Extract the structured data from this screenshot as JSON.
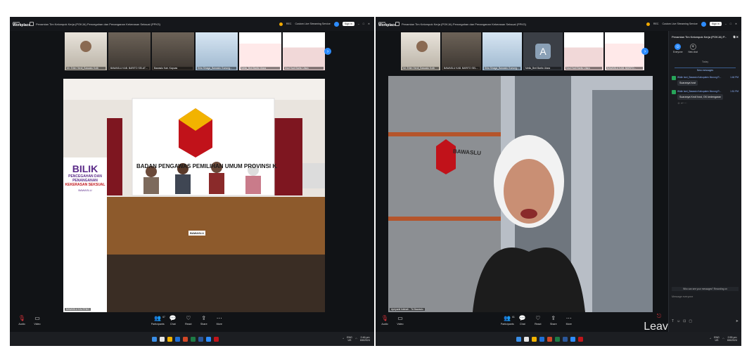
{
  "app": {
    "brand_top": "zoom",
    "brand_bottom": "Workplace",
    "meeting_title": "Penamian Tim Kelompok Kerja (POKJA) Pencegahan dan Penanganan Kekerasan Seksual (PPKS)",
    "rec": "REC",
    "streaming": "Custom Live Streaming Service",
    "sign_in": "Sign in"
  },
  "left_screen": {
    "participants": [
      {
        "name": "Mr. Erlim Herdi_Bawaslu Kotb"
      },
      {
        "name": "BAWASLU KAB. BARITO SELATAN"
      },
      {
        "name": "Bawaslu Kab. Kapuas"
      },
      {
        "name": "Siria Sinaga_Bawaslu Gunung..."
      },
      {
        "name": "Mella_Bmt Barito Utara"
      },
      {
        "name": "Mad Hadi Barito Utara"
      }
    ],
    "stage": {
      "banner": "BADAN PENGAWAS PEMILIHAN UMUM PROVINSI KALIMANTAN TENGAH",
      "standee_title": "BILIK",
      "standee_sub1": "PENCEGAHAN DAN",
      "standee_sub2": "PENANGANAN",
      "standee_sub3": "KEKERASAN SEKSUAL",
      "standee_org": "BAWASLU",
      "desk_label": "BAWASLU",
      "name_bar": "BAWASLU KALTENG"
    },
    "toolbar": {
      "audio": "Audio",
      "video": "Video",
      "participants": "Participants",
      "participants_count": "67",
      "chat": "Chat",
      "react": "React",
      "share": "Share",
      "more": "More"
    },
    "taskbar": {
      "lang1": "ENG",
      "lang2": "US",
      "time": "2:46 pm",
      "date": "6/6/2024"
    }
  },
  "right_screen": {
    "participants": [
      {
        "name": "Mr. Erlim Herdi_Bawaslu Kotb"
      },
      {
        "name": "BAWASLU KAB. BARITO SELAT..."
      },
      {
        "name": "Siria Sinaga_Bawaslu Gunung..."
      },
      {
        "name": "Mella_Bmt Barito Utara"
      },
      {
        "name": "Mad Hadi Barito Utara"
      },
      {
        "name": "BAWASLU KAB. BARITO..."
      }
    ],
    "avatar_letter": "A",
    "speaker_name": "Apriyanti Istimah - TA Bawaslu",
    "building_sign": "BAWASLU",
    "toolbar": {
      "leave": "Leave",
      "audio": "Audio",
      "video": "Video",
      "participants": "Participants",
      "participants_count": "61",
      "chat": "Chat",
      "react": "React",
      "share": "Share",
      "more": "More"
    },
    "chat": {
      "title": "Penamian Tim Kelompok Kerja (POKJA) P...",
      "tab_everyone": "Everyone",
      "tab_new": "New chat",
      "today": "Today",
      "new_messages": "New messages",
      "messages": [
        {
          "from": "Widie Ismi_Bawaslu Kabupaten Murung R...",
          "time": "1:46 PM",
          "text": "Suaranya host"
        },
        {
          "from": "Widie Ismi_Bawaslu Kabupaten Murung R...",
          "time": "1:51 PM",
          "text": "Suaranya Kecil host, GK kedengaran"
        }
      ],
      "who_can_see": "Who can see your messages? Recording on",
      "input_placeholder": "Message everyone"
    },
    "taskbar": {
      "lang1": "ENG",
      "lang2": "US",
      "time": "2:55 pm",
      "date": "6/6/2024"
    }
  },
  "colors": {
    "accent": "#2d8cff",
    "danger": "#e0323a",
    "window_bg": "#111316",
    "brand_red": "#c0141a"
  }
}
